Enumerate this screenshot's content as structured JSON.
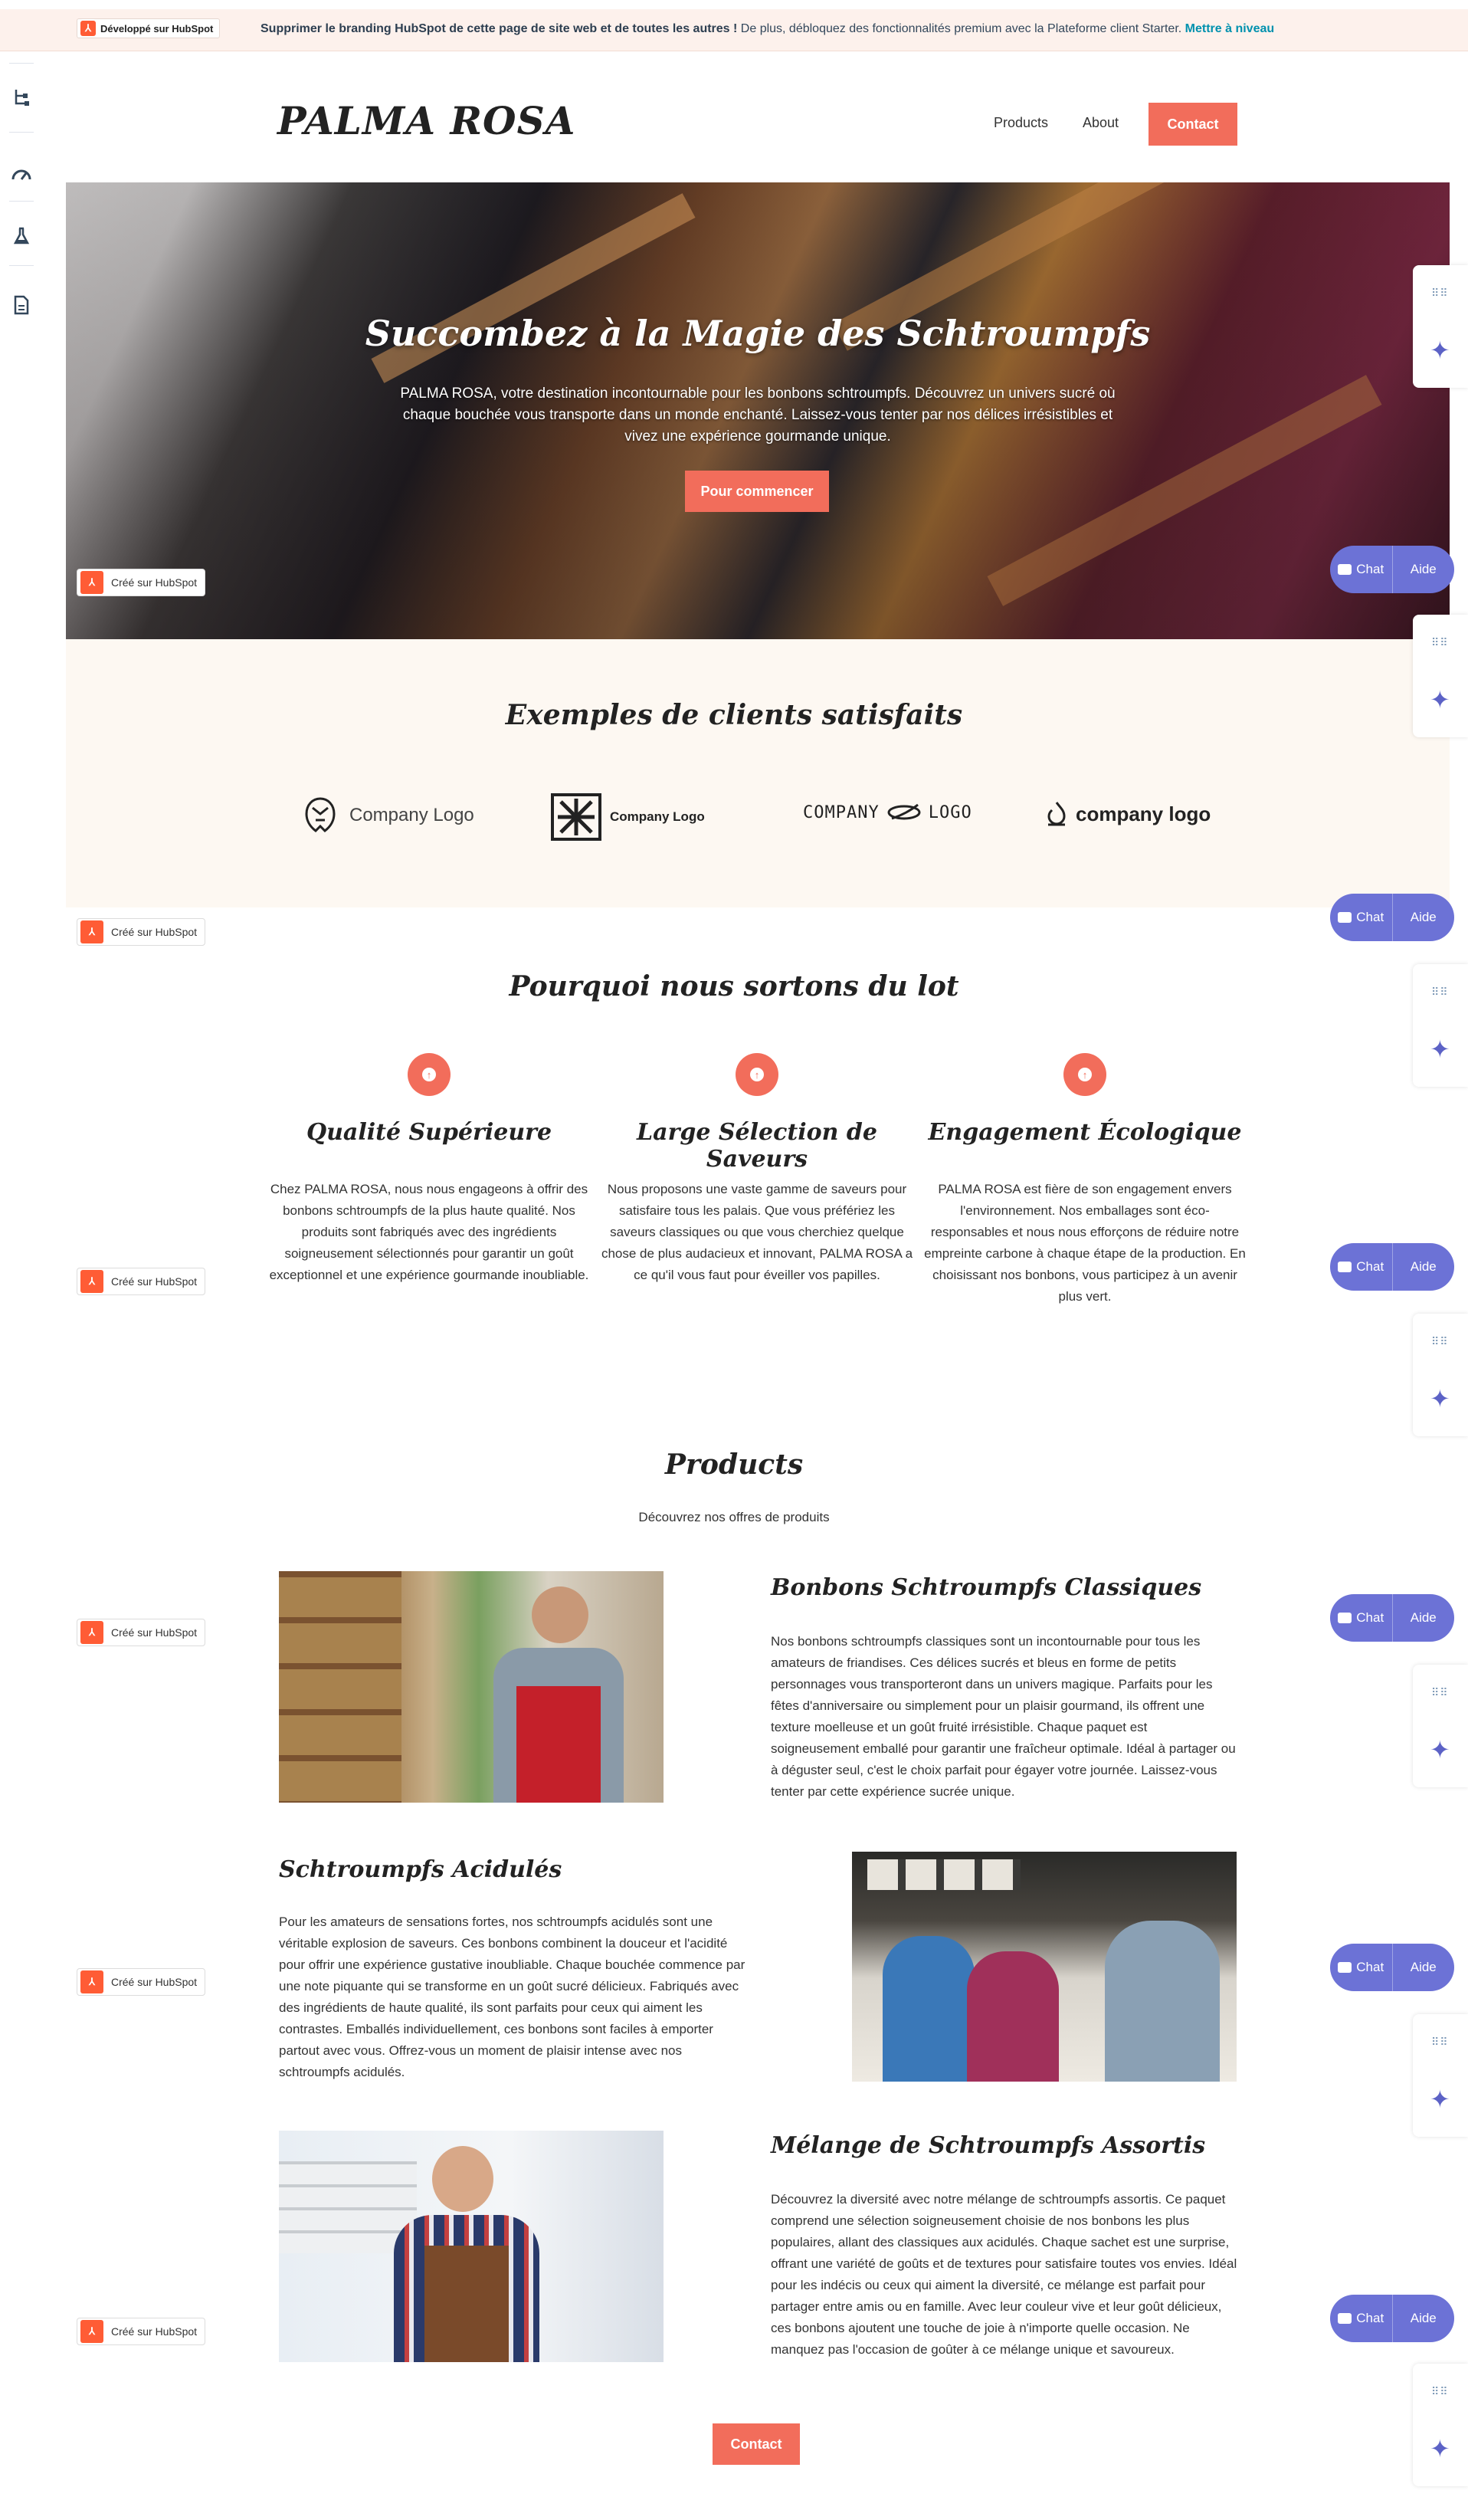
{
  "promo": {
    "badge": "Développé sur HubSpot",
    "text_bold": "Supprimer le branding HubSpot de cette page de site web et de toutes les autres !",
    "text": " De plus, débloquez des fonctionnalités premium avec la Plateforme client Starter. ",
    "link": "Mettre à niveau"
  },
  "rail": {
    "icons": [
      "plus-icon",
      "tree-icon",
      "gauge-icon",
      "flask-icon",
      "page-icon"
    ]
  },
  "nav": {
    "brand": "PALMA ROSA",
    "links": [
      "Products",
      "About"
    ],
    "contact": "Contact"
  },
  "hero": {
    "title": "Succombez à la Magie des Schtroumpfs",
    "subtitle": "PALMA ROSA, votre destination incontournable pour les bonbons schtroumpfs. Découvrez un univers sucré où chaque bouchée vous transporte dans un monde enchanté. Laissez-vous tenter par nos délices irrésistibles et vivez une expérience gourmande unique.",
    "cta": "Pour commencer"
  },
  "hs_pill": "Créé sur HubSpot",
  "hs_mark": "⅄",
  "clients": {
    "title": "Exemples de clients satisfaits",
    "logos": [
      "Company Logo",
      "Company Logo",
      "COMPANY",
      "LOGO",
      "company logo"
    ]
  },
  "features": {
    "title": "Pourquoi nous sortons du lot",
    "items": [
      {
        "title": "Qualité Supérieure",
        "body": "Chez PALMA ROSA, nous nous engageons à offrir des bonbons schtroumpfs de la plus haute qualité. Nos produits sont fabriqués avec des ingrédients soigneusement sélectionnés pour garantir un goût exceptionnel et une expérience gourmande inoubliable."
      },
      {
        "title": "Large Sélection de Saveurs",
        "body": "Nous proposons une vaste gamme de saveurs pour satisfaire tous les palais. Que vous préfériez les saveurs classiques ou que vous cherchiez quelque chose de plus audacieux et innovant, PALMA ROSA a ce qu'il vous faut pour éveiller vos papilles."
      },
      {
        "title": "Engagement Écologique",
        "body": "PALMA ROSA est fière de son engagement envers l'environnement. Nos emballages sont éco-responsables et nous nous efforçons de réduire notre empreinte carbone à chaque étape de la production. En choisissant nos bonbons, vous participez à un avenir plus vert."
      }
    ]
  },
  "products": {
    "title": "Products",
    "subtitle": "Découvrez nos offres de produits",
    "items": [
      {
        "title": "Bonbons Schtroumpfs Classiques",
        "body": "Nos bonbons schtroumpfs classiques sont un incontournable pour tous les amateurs de friandises. Ces délices sucrés et bleus en forme de petits personnages vous transporteront dans un univers magique. Parfaits pour les fêtes d'anniversaire ou simplement pour un plaisir gourmand, ils offrent une texture moelleuse et un goût fruité irrésistible. Chaque paquet est soigneusement emballé pour garantir une fraîcheur optimale. Idéal à partager ou à déguster seul, c'est le choix parfait pour égayer votre journée. Laissez-vous tenter par cette expérience sucrée unique."
      },
      {
        "title": "Schtroumpfs Acidulés",
        "body": "Pour les amateurs de sensations fortes, nos schtroumpfs acidulés sont une véritable explosion de saveurs. Ces bonbons combinent la douceur et l'acidité pour offrir une expérience gustative inoubliable. Chaque bouchée commence par une note piquante qui se transforme en un goût sucré délicieux. Fabriqués avec des ingrédients de haute qualité, ils sont parfaits pour ceux qui aiment les contrastes. Emballés individuellement, ces bonbons sont faciles à emporter partout avec vous. Offrez-vous un moment de plaisir intense avec nos schtroumpfs acidulés."
      },
      {
        "title": "Mélange de Schtroumpfs Assortis",
        "body": "Découvrez la diversité avec notre mélange de schtroumpfs assortis. Ce paquet comprend une sélection soigneusement choisie de nos bonbons les plus populaires, allant des classiques aux acidulés. Chaque sachet est une surprise, offrant une variété de goûts et de textures pour satisfaire toutes vos envies. Idéal pour les indécis ou ceux qui aiment la diversité, ce mélange est parfait pour partager entre amis ou en famille. Avec leur couleur vive et leur goût délicieux, ces bonbons ajoutent une touche de joie à n'importe quelle occasion. Ne manquez pas l'occasion de goûter à ce mélange unique et savoureux."
      }
    ],
    "contact": "Contact"
  },
  "widgets": {
    "grip": "⠿⠿",
    "spark": "✦",
    "chat": "Chat",
    "help": "Aide"
  },
  "colors": {
    "accent": "#f26d5b",
    "chat": "#6c72d6",
    "hubspot": "#ff5c35",
    "clients_bg": "#fdf8f2"
  }
}
